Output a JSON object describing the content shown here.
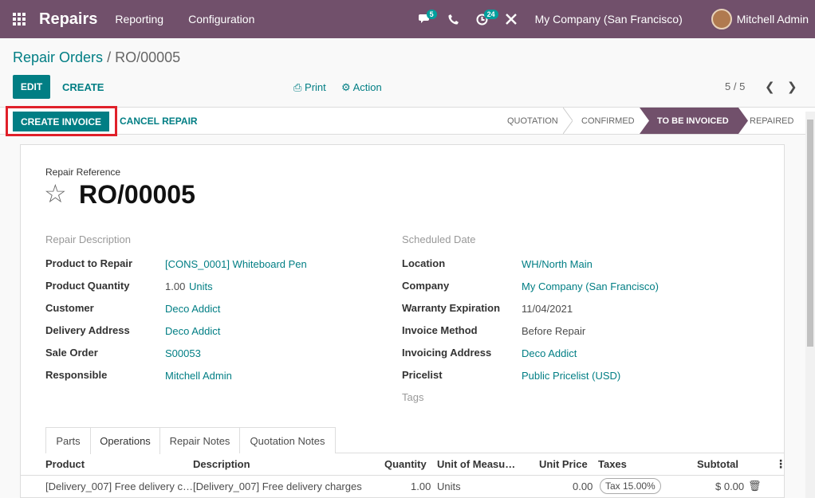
{
  "navbar": {
    "app_name": "Repairs",
    "menu": [
      "Reporting",
      "Configuration"
    ],
    "messages_badge": "5",
    "activities_badge": "24",
    "company": "My Company (San Francisco)",
    "user": "Mitchell Admin"
  },
  "breadcrumb": {
    "parent": "Repair Orders",
    "separator": "/",
    "current": "RO/00005"
  },
  "controls": {
    "edit": "EDIT",
    "create": "CREATE",
    "print": "Print",
    "action": "Action",
    "pager": "5 / 5"
  },
  "statusbar": {
    "create_invoice": "CREATE INVOICE",
    "cancel_repair": "CANCEL REPAIR",
    "stages": [
      "QUOTATION",
      "CONFIRMED",
      "TO BE INVOICED",
      "REPAIRED"
    ],
    "current_stage": "TO BE INVOICED"
  },
  "form": {
    "ref_label": "Repair Reference",
    "ref": "RO/00005",
    "repair_description": "Repair Description",
    "scheduled_date": "Scheduled Date",
    "left": [
      {
        "label": "Product to Repair",
        "value": "[CONS_0001] Whiteboard Pen"
      },
      {
        "label": "Product Quantity",
        "value": "1.00",
        "unit": "Units"
      },
      {
        "label": "Customer",
        "value": "Deco Addict"
      },
      {
        "label": "Delivery Address",
        "value": "Deco Addict"
      },
      {
        "label": "Sale Order",
        "value": "S00053"
      },
      {
        "label": "Responsible",
        "value": "Mitchell Admin"
      }
    ],
    "right": [
      {
        "label": "Location",
        "value": "WH/North Main"
      },
      {
        "label": "Company",
        "value": "My Company (San Francisco)"
      },
      {
        "label": "Warranty Expiration",
        "value": "11/04/2021"
      },
      {
        "label": "Invoice Method",
        "value": "Before Repair"
      },
      {
        "label": "Invoicing Address",
        "value": "Deco Addict"
      },
      {
        "label": "Pricelist",
        "value": "Public Pricelist (USD)"
      }
    ],
    "tags": "Tags"
  },
  "tabs": [
    "Parts",
    "Operations",
    "Repair Notes",
    "Quotation Notes"
  ],
  "active_tab": "Operations",
  "table": {
    "columns": [
      "Product",
      "Description",
      "Quantity",
      "Unit of Measu…",
      "Unit Price",
      "Taxes",
      "Subtotal"
    ],
    "rows": [
      {
        "product": "[Delivery_007] Free delivery c…",
        "description": "[Delivery_007] Free delivery charges",
        "quantity": "1.00",
        "uom": "Units",
        "unit_price": "0.00",
        "tax": "Tax 15.00%",
        "subtotal": "$ 0.00"
      }
    ]
  },
  "colors": {
    "navbar": "#71506b",
    "primary": "#017e84",
    "highlight_box": "#e0202a"
  },
  "icons": [
    "apps-icon",
    "chat-icon",
    "phone-icon",
    "activity-icon",
    "tools-icon",
    "print-icon",
    "gear-icon",
    "chevron-left-icon",
    "chevron-right-icon",
    "star-icon",
    "trash-icon",
    "kebab-icon"
  ]
}
